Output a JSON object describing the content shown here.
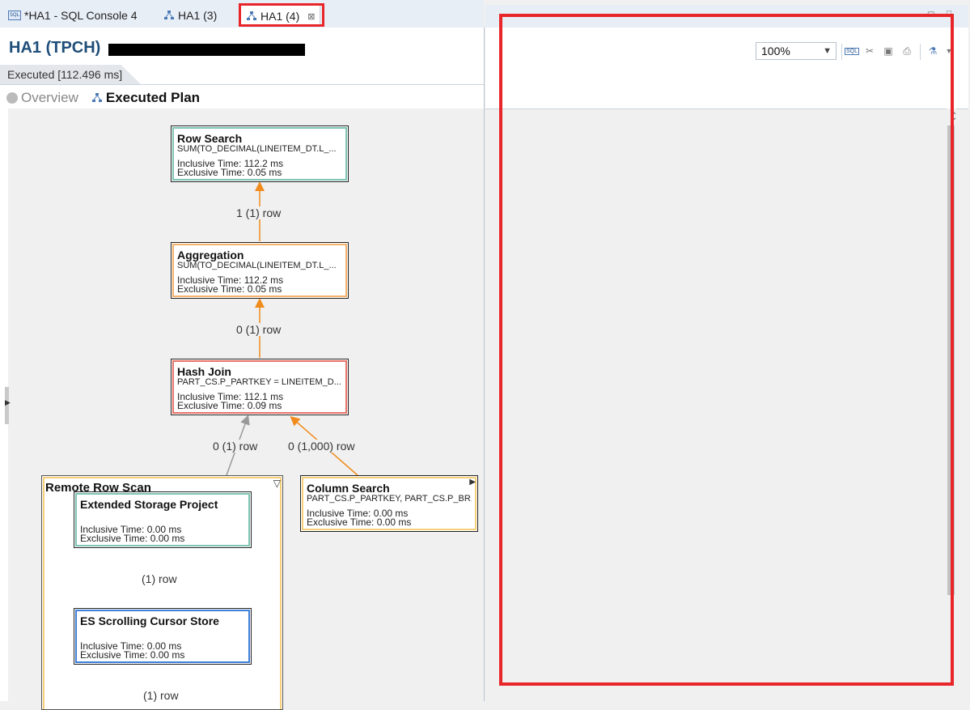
{
  "tabs": [
    {
      "label": "*HA1 - SQL Console 4",
      "icon": "sql-console-icon"
    },
    {
      "label": "HA1 (3)",
      "icon": "plan-viz-icon"
    },
    {
      "label": "HA1 (4)",
      "icon": "plan-viz-icon",
      "active": true
    }
  ],
  "header": {
    "title": "HA1 (TPCH)"
  },
  "execution": {
    "tab_label": "Executed [112.496 ms]"
  },
  "subtabs": {
    "overview": "Overview",
    "executed_plan": "Executed Plan"
  },
  "toolbar": {
    "zoom_value": "100%"
  },
  "plan": {
    "nodes": {
      "row_search": {
        "name": "Row Search",
        "detail": "SUM(TO_DECIMAL(LINEITEM_DT.L_...",
        "inclusive": "Inclusive Time: 112.2 ms",
        "exclusive": "Exclusive Time: 0.05 ms"
      },
      "aggregation": {
        "name": "Aggregation",
        "detail": "SUM(TO_DECIMAL(LINEITEM_DT.L_...",
        "inclusive": "Inclusive Time: 112.2 ms",
        "exclusive": "Exclusive Time: 0.05 ms"
      },
      "hash_join": {
        "name": "Hash Join",
        "detail": "PART_CS.P_PARTKEY = LINEITEM_D...",
        "inclusive": "Inclusive Time: 112.1 ms",
        "exclusive": "Exclusive Time: 0.09 ms"
      },
      "remote_row_scan": {
        "name": "Remote Row Scan"
      },
      "extended_storage_project": {
        "name": "Extended Storage Project",
        "inclusive": "Inclusive Time: 0.00 ms",
        "exclusive": "Exclusive Time: 0.00 ms"
      },
      "es_scrolling_cursor_store": {
        "name": "ES Scrolling Cursor Store",
        "inclusive": "Inclusive Time: 0.00 ms",
        "exclusive": "Exclusive Time: 0.00 ms"
      },
      "column_search": {
        "name": "Column Search",
        "detail": "PART_CS.P_PARTKEY, PART_CS.P_BR...",
        "inclusive": "Inclusive Time: 0.00 ms",
        "exclusive": "Exclusive Time: 0.00 ms"
      }
    },
    "edges": {
      "agg_to_rowsearch": "1 (1) row",
      "join_to_agg": "0 (1) row",
      "remote_to_join": "0 (1) row",
      "column_to_join": "0 (1,000) row",
      "cursor_to_project": "(1) row",
      "below_cursor": "(1) row"
    }
  },
  "colors": {
    "row_search_border": "#7ec4b4",
    "aggregation_border": "#f5b26b",
    "hash_join_border": "#e8746a",
    "remote_border": "#f5cf7a",
    "project_border": "#7ec4b4",
    "cursor_border": "#3f7fd8",
    "column_search_border": "#f5cf7a",
    "edge_orange": "#f08c1e",
    "edge_gray": "#999999",
    "highlight_red": "#e8262a"
  }
}
